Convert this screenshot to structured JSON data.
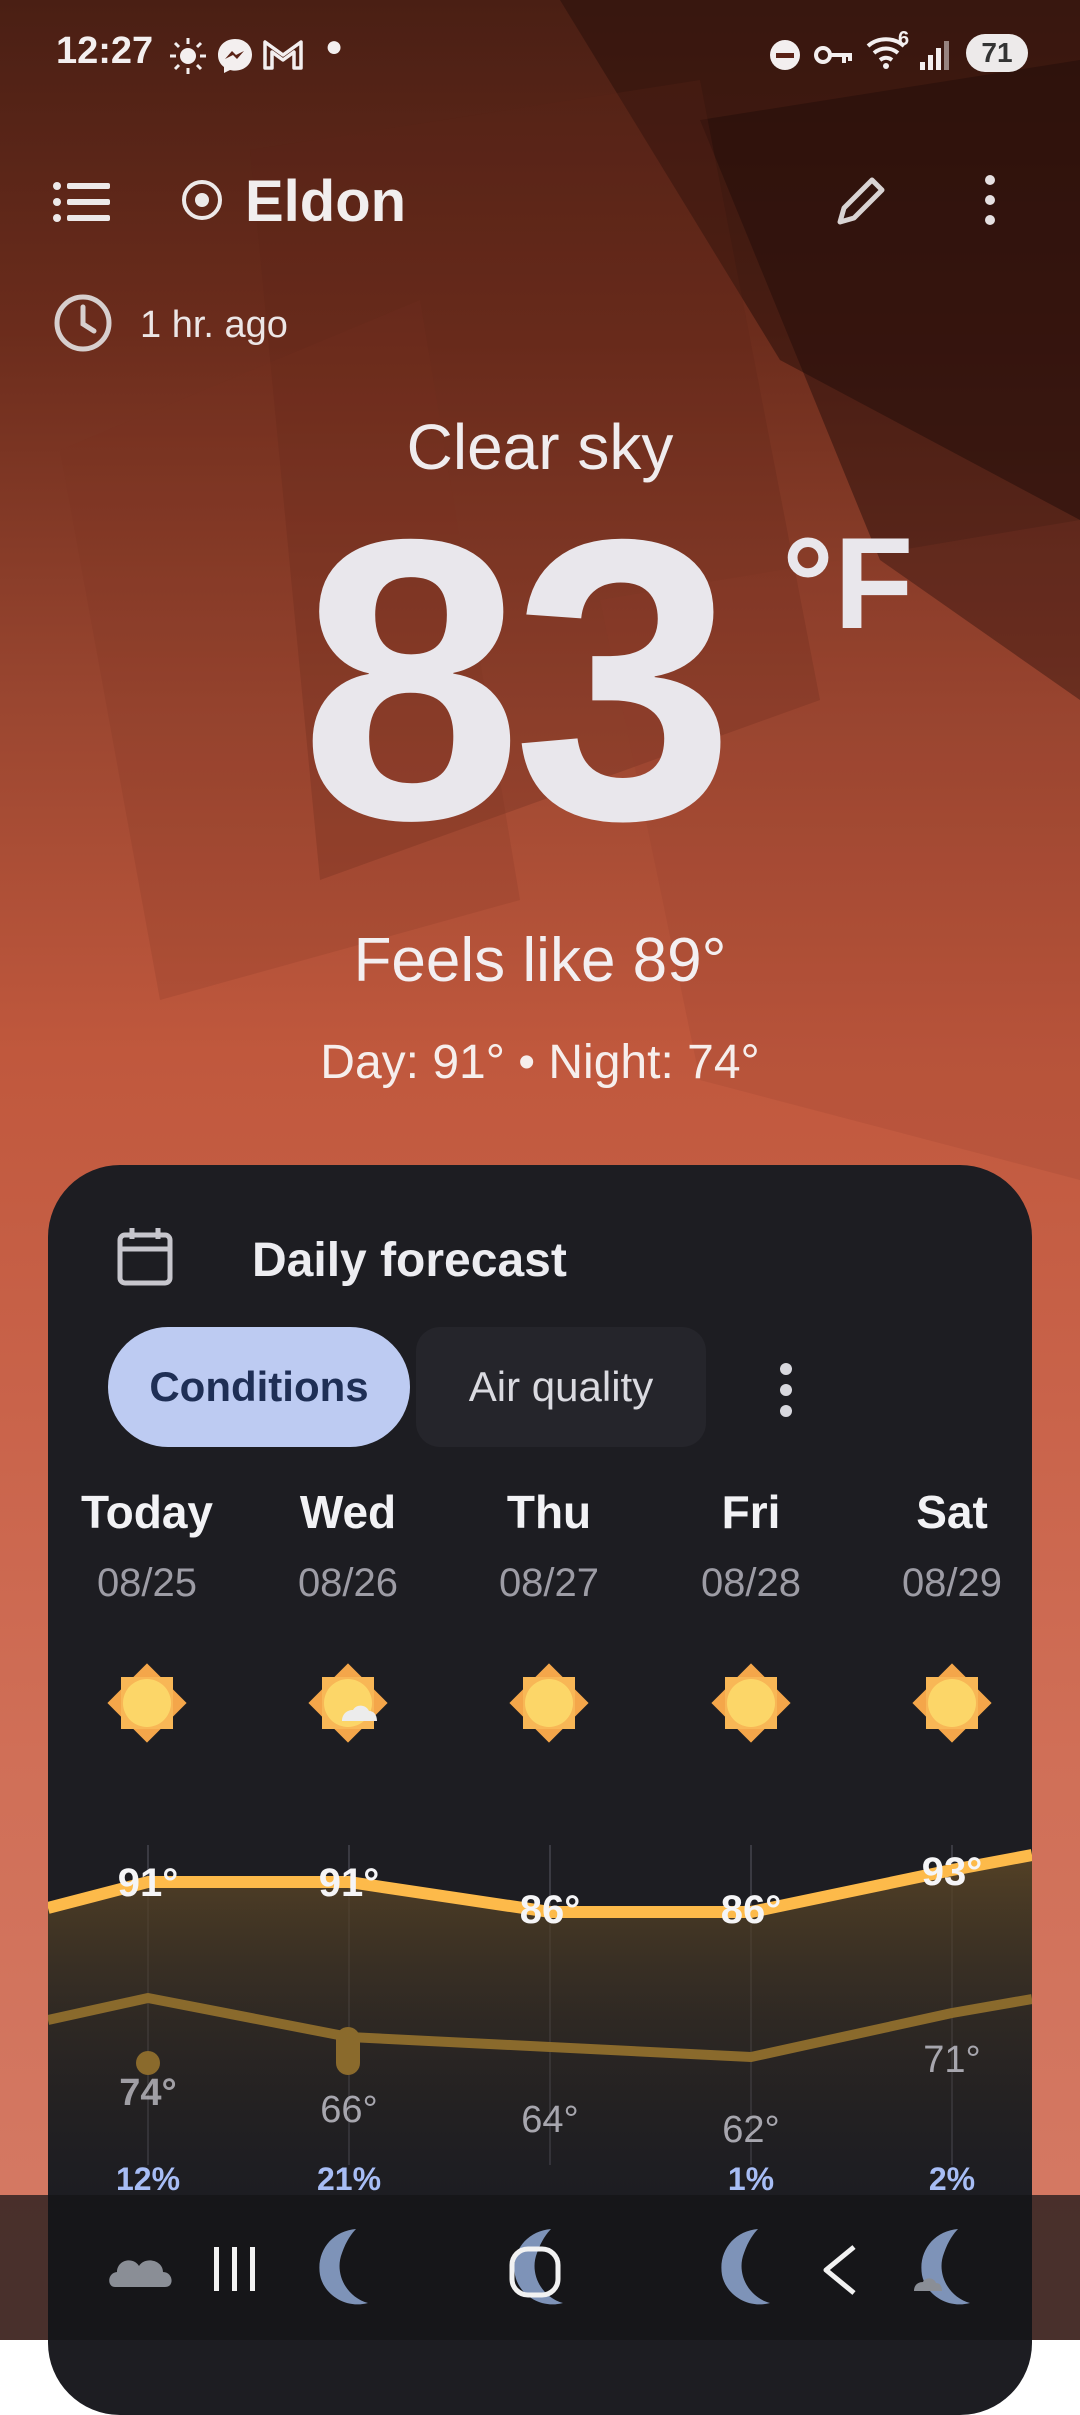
{
  "status_bar": {
    "time": "12:27",
    "battery": "71",
    "signal_badge": "6"
  },
  "header": {
    "location": "Eldon",
    "updated": "1 hr. ago"
  },
  "current": {
    "condition": "Clear sky",
    "temperature": "83",
    "unit": "°F",
    "feels_like": "Feels like 89°",
    "day_night": "Day: 91° • Night: 74°"
  },
  "forecast": {
    "title": "Daily forecast",
    "tabs": [
      "Conditions",
      "Air quality"
    ],
    "days": [
      {
        "name": "Today",
        "date": "08/25",
        "high": "91°",
        "low": "74°",
        "precip": "12%",
        "icon": "sun-icon"
      },
      {
        "name": "Wed",
        "date": "08/26",
        "high": "91°",
        "low": "66°",
        "precip": "21%",
        "icon": "sun-cloud-icon"
      },
      {
        "name": "Thu",
        "date": "08/27",
        "high": "86°",
        "low": "64°",
        "precip": "",
        "icon": "sun-icon"
      },
      {
        "name": "Fri",
        "date": "08/28",
        "high": "86°",
        "low": "62°",
        "precip": "1%",
        "icon": "sun-icon"
      },
      {
        "name": "Sat",
        "date": "08/29",
        "high": "93°",
        "low": "71°",
        "precip": "2%",
        "icon": "sun-icon"
      }
    ],
    "high_values": [
      91,
      91,
      86,
      86,
      93
    ],
    "low_values": [
      74,
      66,
      64,
      62,
      71
    ],
    "colors": {
      "high_line": "#FDBA4A",
      "low_line": "#8A6A2C",
      "precip": "#A7BDF5"
    }
  }
}
